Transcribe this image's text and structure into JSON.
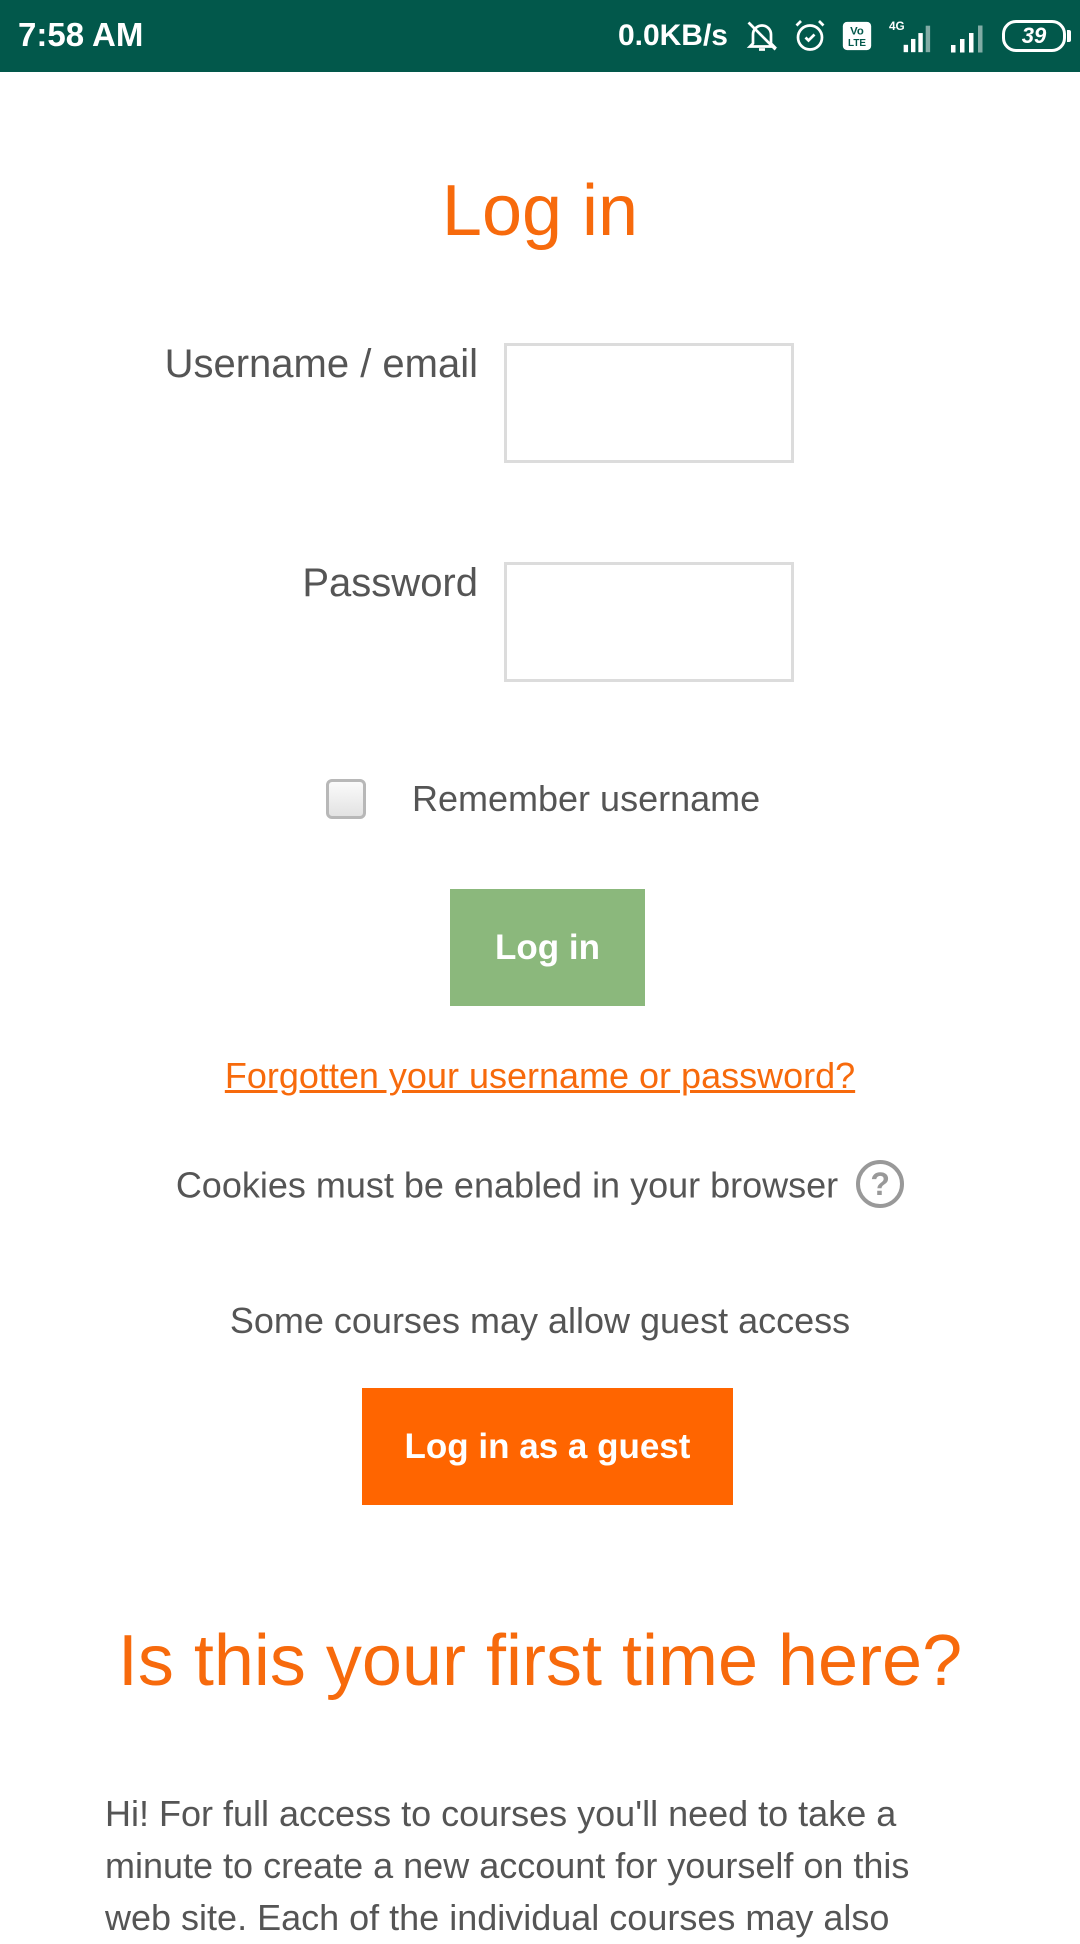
{
  "status_bar": {
    "time": "7:58 AM",
    "network_speed": "0.0KB/s",
    "network_type": "4G",
    "battery": "39",
    "icons": [
      "bell-off-icon",
      "alarm-icon",
      "volte-icon",
      "signal-4g-icon",
      "signal-icon",
      "battery-icon"
    ]
  },
  "login": {
    "title": "Log in",
    "username_label": "Username / email",
    "username_value": "",
    "password_label": "Password",
    "password_value": "",
    "remember_label": "Remember username",
    "remember_checked": false,
    "login_button": "Log in",
    "forgot_link": "Forgotten your username or password?",
    "cookies_notice": "Cookies must be enabled in your browser",
    "guest_note": "Some courses may allow guest access",
    "guest_button": "Log in as a guest"
  },
  "signup": {
    "title": "Is this your first time here?",
    "intro": "Hi! For full access to courses you'll need to take a minute to create a new account for yourself on this web site. Each of the individual courses may also"
  },
  "colors": {
    "status_bar": "#02584b",
    "accent": "#f76a0c",
    "login_button": "#8bb87c",
    "guest_button": "#ff6500",
    "text": "#555555"
  }
}
